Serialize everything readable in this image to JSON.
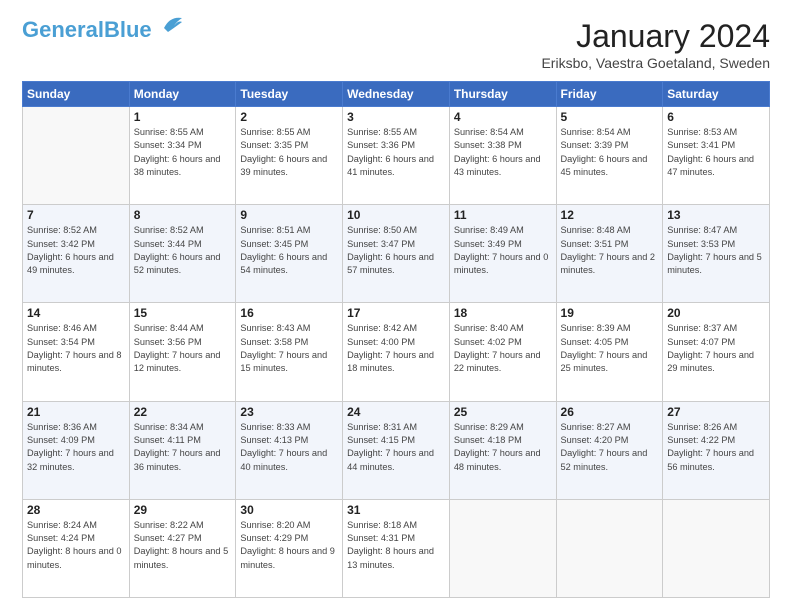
{
  "header": {
    "logo_line1": "General",
    "logo_line2": "Blue",
    "month_title": "January 2024",
    "subtitle": "Eriksbo, Vaestra Goetaland, Sweden"
  },
  "weekdays": [
    "Sunday",
    "Monday",
    "Tuesday",
    "Wednesday",
    "Thursday",
    "Friday",
    "Saturday"
  ],
  "weeks": [
    [
      {
        "day": "",
        "sunrise": "",
        "sunset": "",
        "daylight": ""
      },
      {
        "day": "1",
        "sunrise": "Sunrise: 8:55 AM",
        "sunset": "Sunset: 3:34 PM",
        "daylight": "Daylight: 6 hours and 38 minutes."
      },
      {
        "day": "2",
        "sunrise": "Sunrise: 8:55 AM",
        "sunset": "Sunset: 3:35 PM",
        "daylight": "Daylight: 6 hours and 39 minutes."
      },
      {
        "day": "3",
        "sunrise": "Sunrise: 8:55 AM",
        "sunset": "Sunset: 3:36 PM",
        "daylight": "Daylight: 6 hours and 41 minutes."
      },
      {
        "day": "4",
        "sunrise": "Sunrise: 8:54 AM",
        "sunset": "Sunset: 3:38 PM",
        "daylight": "Daylight: 6 hours and 43 minutes."
      },
      {
        "day": "5",
        "sunrise": "Sunrise: 8:54 AM",
        "sunset": "Sunset: 3:39 PM",
        "daylight": "Daylight: 6 hours and 45 minutes."
      },
      {
        "day": "6",
        "sunrise": "Sunrise: 8:53 AM",
        "sunset": "Sunset: 3:41 PM",
        "daylight": "Daylight: 6 hours and 47 minutes."
      }
    ],
    [
      {
        "day": "7",
        "sunrise": "Sunrise: 8:52 AM",
        "sunset": "Sunset: 3:42 PM",
        "daylight": "Daylight: 6 hours and 49 minutes."
      },
      {
        "day": "8",
        "sunrise": "Sunrise: 8:52 AM",
        "sunset": "Sunset: 3:44 PM",
        "daylight": "Daylight: 6 hours and 52 minutes."
      },
      {
        "day": "9",
        "sunrise": "Sunrise: 8:51 AM",
        "sunset": "Sunset: 3:45 PM",
        "daylight": "Daylight: 6 hours and 54 minutes."
      },
      {
        "day": "10",
        "sunrise": "Sunrise: 8:50 AM",
        "sunset": "Sunset: 3:47 PM",
        "daylight": "Daylight: 6 hours and 57 minutes."
      },
      {
        "day": "11",
        "sunrise": "Sunrise: 8:49 AM",
        "sunset": "Sunset: 3:49 PM",
        "daylight": "Daylight: 7 hours and 0 minutes."
      },
      {
        "day": "12",
        "sunrise": "Sunrise: 8:48 AM",
        "sunset": "Sunset: 3:51 PM",
        "daylight": "Daylight: 7 hours and 2 minutes."
      },
      {
        "day": "13",
        "sunrise": "Sunrise: 8:47 AM",
        "sunset": "Sunset: 3:53 PM",
        "daylight": "Daylight: 7 hours and 5 minutes."
      }
    ],
    [
      {
        "day": "14",
        "sunrise": "Sunrise: 8:46 AM",
        "sunset": "Sunset: 3:54 PM",
        "daylight": "Daylight: 7 hours and 8 minutes."
      },
      {
        "day": "15",
        "sunrise": "Sunrise: 8:44 AM",
        "sunset": "Sunset: 3:56 PM",
        "daylight": "Daylight: 7 hours and 12 minutes."
      },
      {
        "day": "16",
        "sunrise": "Sunrise: 8:43 AM",
        "sunset": "Sunset: 3:58 PM",
        "daylight": "Daylight: 7 hours and 15 minutes."
      },
      {
        "day": "17",
        "sunrise": "Sunrise: 8:42 AM",
        "sunset": "Sunset: 4:00 PM",
        "daylight": "Daylight: 7 hours and 18 minutes."
      },
      {
        "day": "18",
        "sunrise": "Sunrise: 8:40 AM",
        "sunset": "Sunset: 4:02 PM",
        "daylight": "Daylight: 7 hours and 22 minutes."
      },
      {
        "day": "19",
        "sunrise": "Sunrise: 8:39 AM",
        "sunset": "Sunset: 4:05 PM",
        "daylight": "Daylight: 7 hours and 25 minutes."
      },
      {
        "day": "20",
        "sunrise": "Sunrise: 8:37 AM",
        "sunset": "Sunset: 4:07 PM",
        "daylight": "Daylight: 7 hours and 29 minutes."
      }
    ],
    [
      {
        "day": "21",
        "sunrise": "Sunrise: 8:36 AM",
        "sunset": "Sunset: 4:09 PM",
        "daylight": "Daylight: 7 hours and 32 minutes."
      },
      {
        "day": "22",
        "sunrise": "Sunrise: 8:34 AM",
        "sunset": "Sunset: 4:11 PM",
        "daylight": "Daylight: 7 hours and 36 minutes."
      },
      {
        "day": "23",
        "sunrise": "Sunrise: 8:33 AM",
        "sunset": "Sunset: 4:13 PM",
        "daylight": "Daylight: 7 hours and 40 minutes."
      },
      {
        "day": "24",
        "sunrise": "Sunrise: 8:31 AM",
        "sunset": "Sunset: 4:15 PM",
        "daylight": "Daylight: 7 hours and 44 minutes."
      },
      {
        "day": "25",
        "sunrise": "Sunrise: 8:29 AM",
        "sunset": "Sunset: 4:18 PM",
        "daylight": "Daylight: 7 hours and 48 minutes."
      },
      {
        "day": "26",
        "sunrise": "Sunrise: 8:27 AM",
        "sunset": "Sunset: 4:20 PM",
        "daylight": "Daylight: 7 hours and 52 minutes."
      },
      {
        "day": "27",
        "sunrise": "Sunrise: 8:26 AM",
        "sunset": "Sunset: 4:22 PM",
        "daylight": "Daylight: 7 hours and 56 minutes."
      }
    ],
    [
      {
        "day": "28",
        "sunrise": "Sunrise: 8:24 AM",
        "sunset": "Sunset: 4:24 PM",
        "daylight": "Daylight: 8 hours and 0 minutes."
      },
      {
        "day": "29",
        "sunrise": "Sunrise: 8:22 AM",
        "sunset": "Sunset: 4:27 PM",
        "daylight": "Daylight: 8 hours and 5 minutes."
      },
      {
        "day": "30",
        "sunrise": "Sunrise: 8:20 AM",
        "sunset": "Sunset: 4:29 PM",
        "daylight": "Daylight: 8 hours and 9 minutes."
      },
      {
        "day": "31",
        "sunrise": "Sunrise: 8:18 AM",
        "sunset": "Sunset: 4:31 PM",
        "daylight": "Daylight: 8 hours and 13 minutes."
      },
      {
        "day": "",
        "sunrise": "",
        "sunset": "",
        "daylight": ""
      },
      {
        "day": "",
        "sunrise": "",
        "sunset": "",
        "daylight": ""
      },
      {
        "day": "",
        "sunrise": "",
        "sunset": "",
        "daylight": ""
      }
    ]
  ]
}
